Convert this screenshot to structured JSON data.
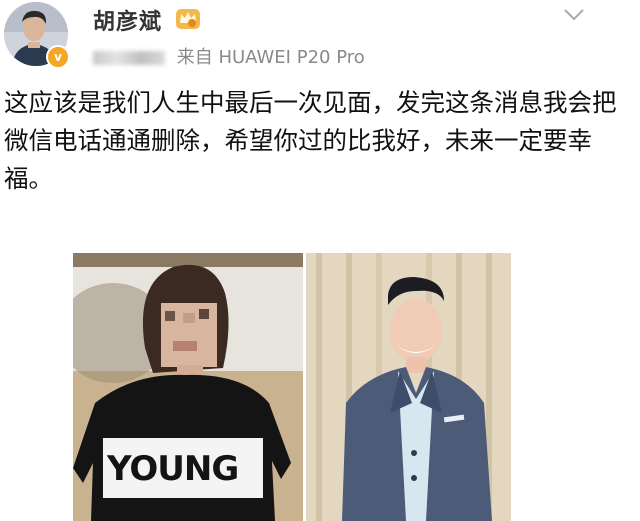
{
  "post": {
    "username": "胡彦斌",
    "source_prefix": "来自",
    "source_device": "HUAWEI P20 Pro",
    "text": "这应该是我们人生中最后一次见面，发完这条消息我会把微信电话通通删除，希望你过的比我好，未来一定要幸福。",
    "verified_badge": "v"
  },
  "photos": {
    "left": {
      "shirt_text": "YOUNG"
    }
  },
  "icons": {
    "avatar": "user-avatar",
    "verified": "verified-badge-icon",
    "vip": "vip-crown-icon",
    "menu": "chevron-down-icon"
  },
  "colors": {
    "username": "#333333",
    "meta": "#8a8a8a",
    "badge": "#f5a623"
  }
}
